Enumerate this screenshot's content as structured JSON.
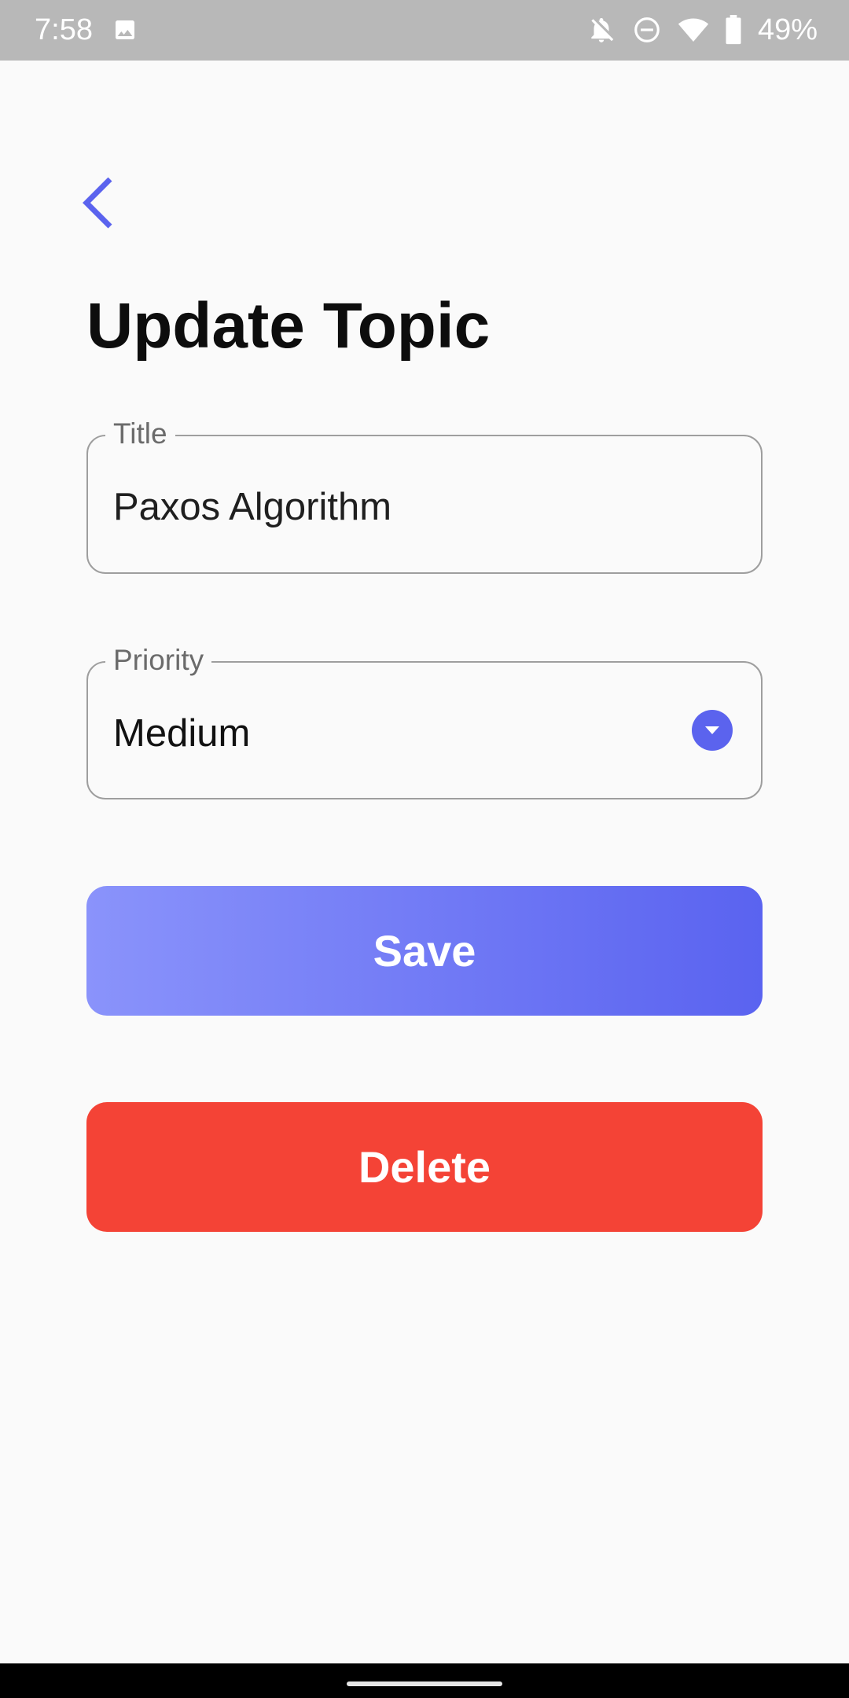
{
  "status_bar": {
    "time": "7:58",
    "battery": "49%",
    "icons": [
      "image-icon",
      "notifications-off-icon",
      "do-not-disturb-icon",
      "wifi-icon",
      "battery-icon"
    ]
  },
  "header": {
    "back_icon": "chevron-left-icon",
    "title": "Update Topic"
  },
  "form": {
    "title_field": {
      "label": "Title",
      "value": "Paxos Algorithm"
    },
    "priority_field": {
      "label": "Priority",
      "value": "Medium",
      "icon": "dropdown-arrow-icon"
    }
  },
  "actions": {
    "save_label": "Save",
    "delete_label": "Delete"
  },
  "colors": {
    "accent": "#5b63ee",
    "save_gradient_start": "#8a93fb",
    "save_gradient_end": "#5a63f0",
    "delete": "#f44336",
    "status_bar": "#b8b8b8"
  }
}
